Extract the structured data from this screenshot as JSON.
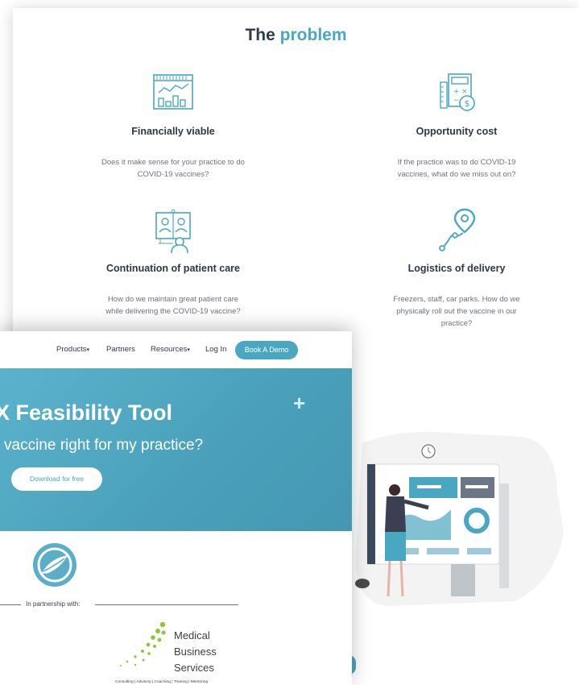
{
  "problem": {
    "title_main": "The",
    "title_accent": "problem",
    "features": [
      {
        "icon": "chart-window-icon",
        "title": "Financially viable",
        "text_line1": "Does it make sense for your practice to do",
        "text_line2": "COVID-19 vaccines?"
      },
      {
        "icon": "calculator-dollar-icon",
        "title": "Opportunity cost",
        "text_line1": "If the practice was to do COVID-19",
        "text_line2": "vaccines, what do we miss out on?"
      },
      {
        "icon": "video-call-icon",
        "title": "Continuation of patient care",
        "text_line1": "How do we maintain great patient care",
        "text_line2": "while delivering the COVID-19 vaccine?"
      },
      {
        "icon": "route-pin-icon",
        "title": "Logistics of delivery",
        "text_line1": "Freezers, staff, car parks. How do we",
        "text_line2": "physically roll out the vaccine in our",
        "text_line3": "practice?"
      }
    ]
  },
  "nav": {
    "products": "Products",
    "partners": "Partners",
    "resources": "Resources",
    "login": "Log In",
    "book_demo": "Book A Demo"
  },
  "hero": {
    "title": "X Feasibility Tool",
    "subtitle": "vaccine right for my practice?",
    "download": "Download for free"
  },
  "partnership": {
    "label": "In partnership with:",
    "partner_line1": "Medical",
    "partner_line2": "Business",
    "partner_line3": "Services",
    "tagline": "Consulting | Advisory | Coaching | Training | Mentoring"
  },
  "colors": {
    "accent": "#4aa7c2",
    "heading": "#2e3c4e",
    "partner_green": "#8dc63f"
  }
}
